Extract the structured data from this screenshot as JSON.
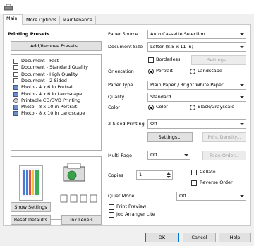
{
  "tabs": [
    "Main",
    "More Options",
    "Maintenance"
  ],
  "printing_presets": {
    "heading": "Printing Presets",
    "add_remove": "Add/Remove Presets...",
    "items": [
      {
        "label": "Document - Fast",
        "icon": "document-icon"
      },
      {
        "label": "Document - Standard Quality",
        "icon": "document-icon"
      },
      {
        "label": "Document - High Quality",
        "icon": "document-icon"
      },
      {
        "label": "Document - 2-Sided",
        "icon": "document-icon"
      },
      {
        "label": "Photo - 4 x 6 in Portrait",
        "icon": "photo-icon"
      },
      {
        "label": "Photo - 4 x 6 in Landscape",
        "icon": "photo-icon"
      },
      {
        "label": "Printable CD/DVD Printing",
        "icon": "cd-icon"
      },
      {
        "label": "Photo - 8 x 10 in Portrait",
        "icon": "photo-icon"
      },
      {
        "label": "Photo - 8 x 10 in Landscape",
        "icon": "photo-icon"
      }
    ]
  },
  "left_buttons": {
    "show_settings": "Show Settings",
    "reset_defaults": "Reset Defaults",
    "ink_levels": "Ink Levels"
  },
  "settings": {
    "paper_source_label": "Paper Source",
    "paper_source_value": "Auto Cassette Selection",
    "document_size_label": "Document Size",
    "document_size_value": "Letter (8.5 x 11 in)",
    "borderless_label": "Borderless",
    "borderless_settings": "Settings...",
    "orientation_label": "Orientation",
    "orientation_portrait": "Portrait",
    "orientation_landscape": "Landscape",
    "paper_type_label": "Paper Type",
    "paper_type_value": "Plain Paper / Bright White Paper",
    "quality_label": "Quality",
    "quality_value": "Standard",
    "color_label": "Color",
    "color_color": "Color",
    "color_bw": "Black/Grayscale",
    "two_sided_label": "2-Sided Printing",
    "two_sided_value": "Off",
    "two_sided_settings": "Settings...",
    "print_density": "Print Density...",
    "multipage_label": "Multi-Page",
    "multipage_value": "Off",
    "page_order": "Page Order...",
    "copies_label": "Copies",
    "copies_value": "1",
    "collate_label": "Collate",
    "reverse_order_label": "Reverse Order",
    "quiet_mode_label": "Quiet Mode",
    "quiet_mode_value": "Off",
    "print_preview_label": "Print Preview",
    "job_arranger_label": "Job Arranger Lite"
  },
  "dialog_buttons": {
    "ok": "OK",
    "cancel": "Cancel",
    "help": "Help"
  }
}
